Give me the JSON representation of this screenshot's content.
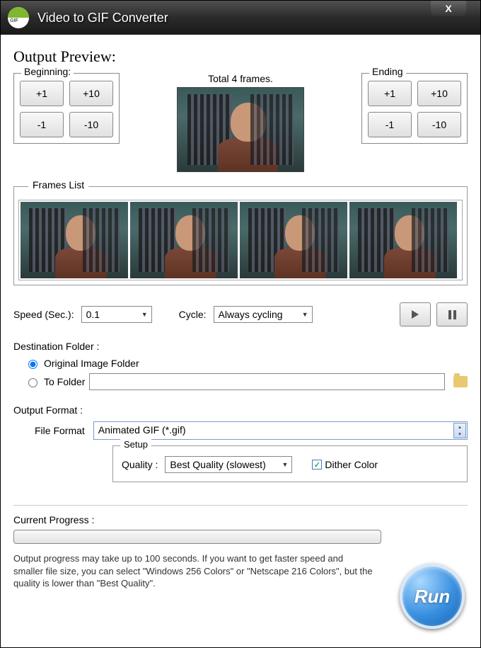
{
  "window": {
    "title": "Video to GIF Converter"
  },
  "preview": {
    "heading": "Output Preview:",
    "total_frames": "Total 4 frames.",
    "beginning": {
      "label": "Beginning:",
      "plus1": "+1",
      "plus10": "+10",
      "minus1": "-1",
      "minus10": "-10"
    },
    "ending": {
      "label": "Ending",
      "plus1": "+1",
      "plus10": "+10",
      "minus1": "-1",
      "minus10": "-10"
    }
  },
  "frames_list": {
    "label": "Frames List",
    "count": 4
  },
  "controls": {
    "speed_label": "Speed (Sec.):",
    "speed_value": "0.1",
    "cycle_label": "Cycle:",
    "cycle_value": "Always cycling"
  },
  "destination": {
    "heading": "Destination Folder :",
    "opt_original": "Original Image Folder",
    "opt_tofolder": "To Folder",
    "selected": "original",
    "folder_path": ""
  },
  "output_format": {
    "heading": "Output Format :",
    "file_format_label": "File Format",
    "file_format_value": "Animated GIF (*.gif)",
    "setup_label": "Setup",
    "quality_label": "Quality :",
    "quality_value": "Best Quality (slowest)",
    "dither_label": "Dither Color",
    "dither_checked": true
  },
  "progress": {
    "heading": "Current Progress :",
    "hint": "Output progress may take up to 100 seconds. If you want to get faster speed and smaller file size, you can select \"Windows 256 Colors\" or \"Netscape 216 Colors\", but the quality is lower than \"Best Quality\"."
  },
  "run": {
    "label": "Run"
  }
}
